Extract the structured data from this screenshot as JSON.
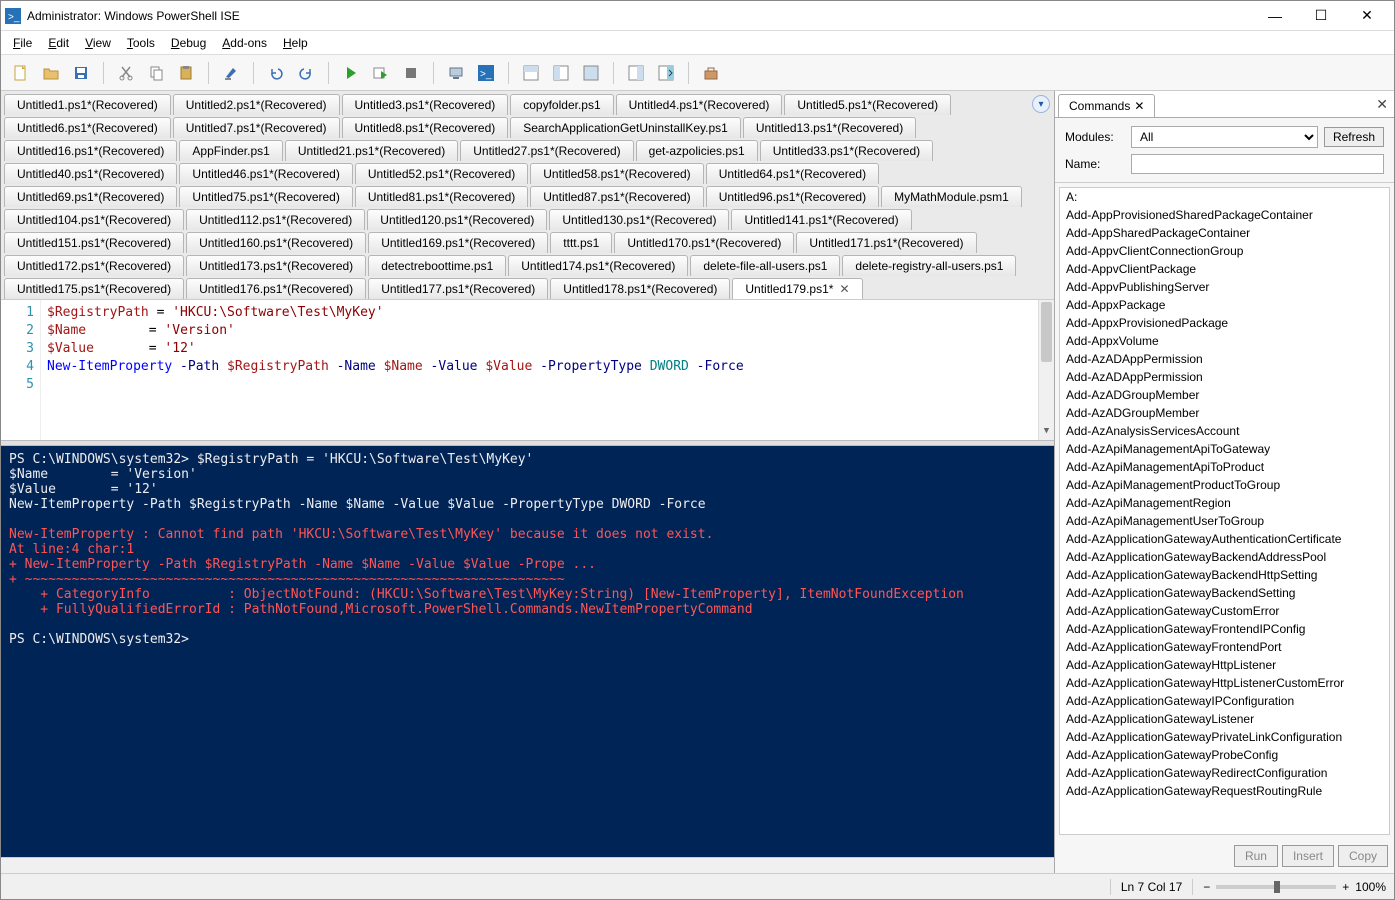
{
  "window": {
    "title": "Administrator: Windows PowerShell ISE"
  },
  "menu": {
    "file": "File",
    "edit": "Edit",
    "view": "View",
    "tools": "Tools",
    "debug": "Debug",
    "addons": "Add-ons",
    "help": "Help"
  },
  "tabs": [
    "Untitled1.ps1*(Recovered)",
    "Untitled2.ps1*(Recovered)",
    "Untitled3.ps1*(Recovered)",
    "copyfolder.ps1",
    "Untitled4.ps1*(Recovered)",
    "Untitled5.ps1*(Recovered)",
    "Untitled6.ps1*(Recovered)",
    "Untitled7.ps1*(Recovered)",
    "Untitled8.ps1*(Recovered)",
    "SearchApplicationGetUninstallKey.ps1",
    "Untitled13.ps1*(Recovered)",
    "Untitled16.ps1*(Recovered)",
    "AppFinder.ps1",
    "Untitled21.ps1*(Recovered)",
    "Untitled27.ps1*(Recovered)",
    "get-azpolicies.ps1",
    "Untitled33.ps1*(Recovered)",
    "Untitled40.ps1*(Recovered)",
    "Untitled46.ps1*(Recovered)",
    "Untitled52.ps1*(Recovered)",
    "Untitled58.ps1*(Recovered)",
    "Untitled64.ps1*(Recovered)",
    "Untitled69.ps1*(Recovered)",
    "Untitled75.ps1*(Recovered)",
    "Untitled81.ps1*(Recovered)",
    "Untitled87.ps1*(Recovered)",
    "Untitled96.ps1*(Recovered)",
    "MyMathModule.psm1",
    "Untitled104.ps1*(Recovered)",
    "Untitled112.ps1*(Recovered)",
    "Untitled120.ps1*(Recovered)",
    "Untitled130.ps1*(Recovered)",
    "Untitled141.ps1*(Recovered)",
    "Untitled151.ps1*(Recovered)",
    "Untitled160.ps1*(Recovered)",
    "Untitled169.ps1*(Recovered)",
    "tttt.ps1",
    "Untitled170.ps1*(Recovered)",
    "Untitled171.ps1*(Recovered)",
    "Untitled172.ps1*(Recovered)",
    "Untitled173.ps1*(Recovered)",
    "detectreboottime.ps1",
    "Untitled174.ps1*(Recovered)",
    "delete-file-all-users.ps1",
    "delete-registry-all-users.ps1",
    "Untitled175.ps1*(Recovered)",
    "Untitled176.ps1*(Recovered)",
    "Untitled177.ps1*(Recovered)",
    "Untitled178.ps1*(Recovered)",
    "Untitled179.ps1*"
  ],
  "activeTabIndex": 49,
  "editor": {
    "lines": [
      {
        "n": 1,
        "tokens": [
          {
            "t": "$RegistryPath",
            "c": "var"
          },
          {
            "t": " = ",
            "c": ""
          },
          {
            "t": "'HKCU:\\Software\\Test\\MyKey'",
            "c": "str"
          }
        ]
      },
      {
        "n": 2,
        "tokens": [
          {
            "t": "$Name",
            "c": "var"
          },
          {
            "t": "        = ",
            "c": ""
          },
          {
            "t": "'Version'",
            "c": "str"
          }
        ]
      },
      {
        "n": 3,
        "tokens": [
          {
            "t": "$Value",
            "c": "var"
          },
          {
            "t": "       = ",
            "c": ""
          },
          {
            "t": "'12'",
            "c": "str"
          }
        ]
      },
      {
        "n": 4,
        "tokens": [
          {
            "t": "New-ItemProperty",
            "c": "cmd"
          },
          {
            "t": " -Path ",
            "c": "param"
          },
          {
            "t": "$RegistryPath",
            "c": "var"
          },
          {
            "t": " -Name ",
            "c": "param"
          },
          {
            "t": "$Name",
            "c": "var"
          },
          {
            "t": " -Value ",
            "c": "param"
          },
          {
            "t": "$Value",
            "c": "var"
          },
          {
            "t": " -PropertyType ",
            "c": "param"
          },
          {
            "t": "DWORD",
            "c": "type"
          },
          {
            "t": " -Force",
            "c": "param"
          }
        ]
      },
      {
        "n": 5,
        "tokens": []
      }
    ]
  },
  "console": {
    "prompt": "PS C:\\WINDOWS\\system32>",
    "input_lines": [
      "PS C:\\WINDOWS\\system32> $RegistryPath = 'HKCU:\\Software\\Test\\MyKey'",
      "$Name        = 'Version'",
      "$Value       = '12'",
      "New-ItemProperty -Path $RegistryPath -Name $Name -Value $Value -PropertyType DWORD -Force",
      ""
    ],
    "error_lines": [
      "New-ItemProperty : Cannot find path 'HKCU:\\Software\\Test\\MyKey' because it does not exist.",
      "At line:4 char:1",
      "+ New-ItemProperty -Path $RegistryPath -Name $Name -Value $Value -Prope ...",
      "+ ~~~~~~~~~~~~~~~~~~~~~~~~~~~~~~~~~~~~~~~~~~~~~~~~~~~~~~~~~~~~~~~~~~~~~",
      "    + CategoryInfo          : ObjectNotFound: (HKCU:\\Software\\Test\\MyKey:String) [New-ItemProperty], ItemNotFoundException",
      "    + FullyQualifiedErrorId : PathNotFound,Microsoft.PowerShell.Commands.NewItemPropertyCommand"
    ],
    "trailing_prompt": "PS C:\\WINDOWS\\system32> "
  },
  "commandsPane": {
    "title": "Commands",
    "modulesLabel": "Modules:",
    "modulesValue": "All",
    "nameLabel": "Name:",
    "nameValue": "",
    "refresh": "Refresh",
    "run": "Run",
    "insert": "Insert",
    "copy": "Copy",
    "items": [
      "A:",
      "Add-AppProvisionedSharedPackageContainer",
      "Add-AppSharedPackageContainer",
      "Add-AppvClientConnectionGroup",
      "Add-AppvClientPackage",
      "Add-AppvPublishingServer",
      "Add-AppxPackage",
      "Add-AppxProvisionedPackage",
      "Add-AppxVolume",
      "Add-AzADAppPermission",
      "Add-AzADAppPermission",
      "Add-AzADGroupMember",
      "Add-AzADGroupMember",
      "Add-AzAnalysisServicesAccount",
      "Add-AzApiManagementApiToGateway",
      "Add-AzApiManagementApiToProduct",
      "Add-AzApiManagementProductToGroup",
      "Add-AzApiManagementRegion",
      "Add-AzApiManagementUserToGroup",
      "Add-AzApplicationGatewayAuthenticationCertificate",
      "Add-AzApplicationGatewayBackendAddressPool",
      "Add-AzApplicationGatewayBackendHttpSetting",
      "Add-AzApplicationGatewayBackendSetting",
      "Add-AzApplicationGatewayCustomError",
      "Add-AzApplicationGatewayFrontendIPConfig",
      "Add-AzApplicationGatewayFrontendPort",
      "Add-AzApplicationGatewayHttpListener",
      "Add-AzApplicationGatewayHttpListenerCustomError",
      "Add-AzApplicationGatewayIPConfiguration",
      "Add-AzApplicationGatewayListener",
      "Add-AzApplicationGatewayPrivateLinkConfiguration",
      "Add-AzApplicationGatewayProbeConfig",
      "Add-AzApplicationGatewayRedirectConfiguration",
      "Add-AzApplicationGatewayRequestRoutingRule"
    ]
  },
  "status": {
    "pos": "Ln 7  Col 17",
    "zoom": "100%"
  }
}
